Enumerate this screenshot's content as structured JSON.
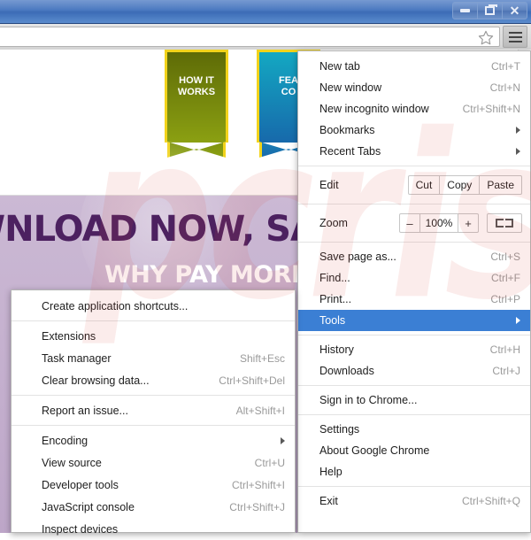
{
  "window": {
    "buttons": [
      {
        "name": "minimize",
        "glyph": "minimize-icon"
      },
      {
        "name": "restore",
        "glyph": "restore-icon"
      },
      {
        "name": "close",
        "glyph": "close-icon",
        "label": "✕"
      }
    ]
  },
  "toolbar": {
    "address_value": "",
    "address_placeholder": "",
    "star_icon": "star-icon",
    "menu_icon": "hamburger-menu-icon"
  },
  "page": {
    "ribbons": [
      {
        "line1": "HOW IT",
        "line2": "WORKS",
        "color": "#8ba012"
      },
      {
        "line1": "FEA",
        "line2": "CO",
        "color": "#1769ab"
      }
    ],
    "headline": "WNLOAD NOW, SAVE",
    "subheadline": "WHY PAY MORE WHE",
    "watermark": "pcrisk"
  },
  "chrome_menu": {
    "items": [
      {
        "type": "item",
        "label": "New tab",
        "accel": "Ctrl+T",
        "name": "new-tab"
      },
      {
        "type": "item",
        "label": "New window",
        "accel": "Ctrl+N",
        "name": "new-window"
      },
      {
        "type": "item",
        "label": "New incognito window",
        "accel": "Ctrl+Shift+N",
        "name": "new-incognito-window"
      },
      {
        "type": "item",
        "label": "Bookmarks",
        "accel": "",
        "submenu": true,
        "name": "bookmarks"
      },
      {
        "type": "item",
        "label": "Recent Tabs",
        "accel": "",
        "submenu": true,
        "name": "recent-tabs"
      },
      {
        "type": "sep"
      },
      {
        "type": "edit-row",
        "label": "Edit",
        "buttons": [
          "Cut",
          "Copy",
          "Paste"
        ],
        "name": "edit"
      },
      {
        "type": "sep"
      },
      {
        "type": "zoom-row",
        "label": "Zoom",
        "minus": "–",
        "value": "100%",
        "plus": "+",
        "fullscreen_icon": "fullscreen-icon",
        "name": "zoom"
      },
      {
        "type": "sep"
      },
      {
        "type": "item",
        "label": "Save page as...",
        "accel": "Ctrl+S",
        "name": "save-page-as"
      },
      {
        "type": "item",
        "label": "Find...",
        "accel": "Ctrl+F",
        "name": "find"
      },
      {
        "type": "item",
        "label": "Print...",
        "accel": "Ctrl+P",
        "name": "print"
      },
      {
        "type": "item",
        "label": "Tools",
        "accel": "",
        "submenu": true,
        "selected": true,
        "name": "tools"
      },
      {
        "type": "sep"
      },
      {
        "type": "item",
        "label": "History",
        "accel": "Ctrl+H",
        "name": "history"
      },
      {
        "type": "item",
        "label": "Downloads",
        "accel": "Ctrl+J",
        "name": "downloads"
      },
      {
        "type": "sep"
      },
      {
        "type": "item",
        "label": "Sign in to Chrome...",
        "accel": "",
        "name": "sign-in-to-chrome"
      },
      {
        "type": "sep"
      },
      {
        "type": "item",
        "label": "Settings",
        "accel": "",
        "name": "settings"
      },
      {
        "type": "item",
        "label": "About Google Chrome",
        "accel": "",
        "name": "about-google-chrome"
      },
      {
        "type": "item",
        "label": "Help",
        "accel": "",
        "name": "help"
      },
      {
        "type": "sep"
      },
      {
        "type": "item",
        "label": "Exit",
        "accel": "Ctrl+Shift+Q",
        "name": "exit"
      }
    ]
  },
  "tools_menu": {
    "items": [
      {
        "type": "item",
        "label": "Create application shortcuts...",
        "accel": "",
        "name": "create-application-shortcuts"
      },
      {
        "type": "sep"
      },
      {
        "type": "item",
        "label": "Extensions",
        "accel": "",
        "name": "extensions"
      },
      {
        "type": "item",
        "label": "Task manager",
        "accel": "Shift+Esc",
        "name": "task-manager"
      },
      {
        "type": "item",
        "label": "Clear browsing data...",
        "accel": "Ctrl+Shift+Del",
        "name": "clear-browsing-data"
      },
      {
        "type": "sep"
      },
      {
        "type": "item",
        "label": "Report an issue...",
        "accel": "Alt+Shift+I",
        "name": "report-an-issue"
      },
      {
        "type": "sep"
      },
      {
        "type": "item",
        "label": "Encoding",
        "accel": "",
        "submenu": true,
        "name": "encoding"
      },
      {
        "type": "item",
        "label": "View source",
        "accel": "Ctrl+U",
        "name": "view-source"
      },
      {
        "type": "item",
        "label": "Developer tools",
        "accel": "Ctrl+Shift+I",
        "name": "developer-tools"
      },
      {
        "type": "item",
        "label": "JavaScript console",
        "accel": "Ctrl+Shift+J",
        "name": "javascript-console"
      },
      {
        "type": "item",
        "label": "Inspect devices",
        "accel": "",
        "name": "inspect-devices"
      }
    ]
  },
  "colors": {
    "highlight": "#3b7fd4",
    "accel_text": "#9a9a9a",
    "titlebar": "#4272bd",
    "hero_purple": "#c3aecd",
    "headline_purple": "#4c2160"
  }
}
